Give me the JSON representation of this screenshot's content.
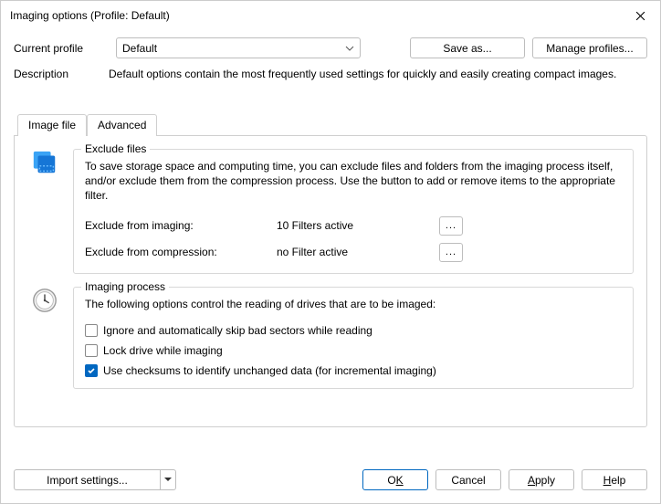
{
  "window": {
    "title": "Imaging options (Profile: Default)"
  },
  "profileRow": {
    "currentProfileLabel": "Current profile",
    "selected": "Default",
    "saveAs": "Save as...",
    "manageProfiles": "Manage profiles..."
  },
  "descriptionRow": {
    "label": "Description",
    "text": "Default options contain the most frequently used settings for quickly and easily creating compact images."
  },
  "tabs": {
    "imageFile": "Image file",
    "advanced": "Advanced"
  },
  "excludeFiles": {
    "legend": "Exclude files",
    "intro": "To save storage space and computing time, you can exclude files and folders from the imaging process itself, and/or exclude them from the compression process. Use the button to add or remove items to the appropriate filter.",
    "imagingLabel": "Exclude from imaging:",
    "imagingVal": "10 Filters active",
    "compressionLabel": "Exclude from compression:",
    "compressionVal": "no Filter active",
    "ellipsis": "..."
  },
  "imagingProcess": {
    "legend": "Imaging process",
    "intro": "The following options control the reading of drives that are to be imaged:",
    "opt1": "Ignore and automatically skip bad sectors while reading",
    "opt2": "Lock drive while imaging",
    "opt3": "Use checksums to identify unchanged data (for incremental imaging)"
  },
  "footer": {
    "import": "Import settings...",
    "ok_pre": "O",
    "ok_u": "K",
    "cancel": "Cancel",
    "apply_u": "A",
    "apply_post": "pply",
    "help_u": "H",
    "help_post": "elp"
  }
}
